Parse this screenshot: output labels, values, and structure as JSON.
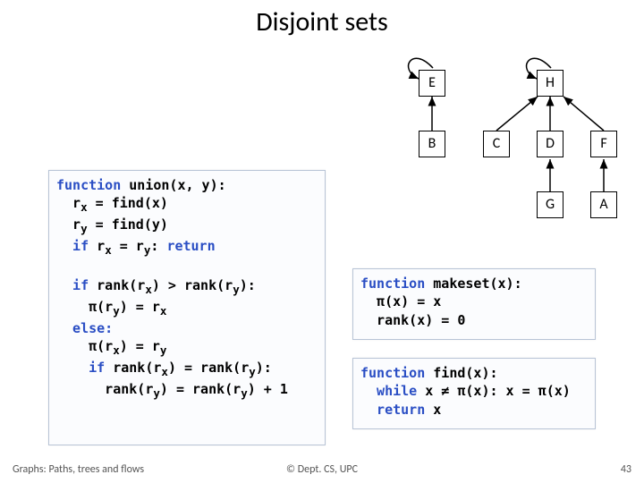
{
  "title": "Disjoint sets",
  "footer": {
    "left": "Graphs: Paths, trees and flows",
    "center": "© Dept. CS, UPC",
    "right": "43"
  },
  "nodes": {
    "E": "E",
    "H": "H",
    "B": "B",
    "C": "C",
    "D": "D",
    "F": "F",
    "G": "G",
    "A": "A"
  },
  "code_union": {
    "l1a": "function",
    "l1b": " union(x, y):",
    "l2": "  r",
    "l2s": "x",
    "l2c": " = find(x)",
    "l3": "  r",
    "l3s": "y",
    "l3c": " = find(y)",
    "l4a": "  if ",
    "l4b": "r",
    "l4s": "x",
    "l4c": " = r",
    "l4s2": "y",
    "l4d": ": ",
    "l4e": "return",
    "l6a": "  if ",
    "l6b": "rank(r",
    "l6s": "x",
    "l6c": ") > rank(r",
    "l6s2": "y",
    "l6d": "):",
    "l7": "    π(r",
    "l7s": "y",
    "l7b": ") = r",
    "l7s2": "x",
    "l8": "  else:",
    "l9": "    π(r",
    "l9s": "x",
    "l9b": ") = r",
    "l9s2": "y",
    "l10a": "    if ",
    "l10b": "rank(r",
    "l10s": "x",
    "l10c": ") = rank(r",
    "l10s2": "y",
    "l10d": "):",
    "l11": "      rank(r",
    "l11s": "y",
    "l11b": ") = rank(r",
    "l11s2": "y",
    "l11c": ") + 1"
  },
  "code_makeset": {
    "l1a": "function",
    "l1b": " makeset(x):",
    "l2": "  π(x) = x",
    "l3": "  rank(x) = 0"
  },
  "code_find": {
    "l1a": "function",
    "l1b": " find(x):",
    "l2a": "  while ",
    "l2b": "x ≠ π(x): x = π(x)",
    "l3a": "  return ",
    "l3b": "x"
  }
}
